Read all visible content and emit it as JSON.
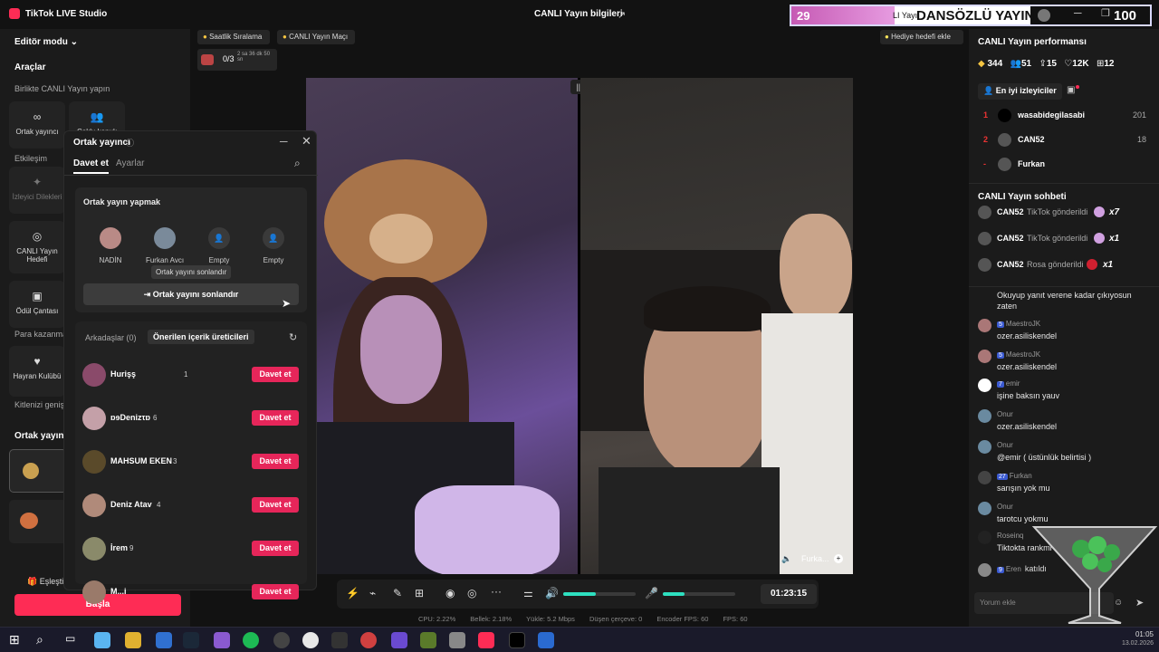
{
  "app": {
    "title": "TikTok LIVE Studio",
    "window_title": "CANLI Yayın bilgileri"
  },
  "overlay": {
    "num1": "29",
    "title": "DANSÖZLÜ YAYIN",
    "sub": "LI Yayı",
    "num2": "100"
  },
  "left": {
    "editor_mode": "Editör modu",
    "tools": "Araçlar",
    "together": "Birlikte CANLI Yayın yapın",
    "cohost_btn": "Ortak yayıncı",
    "multi_btn": "Çoklu konuk",
    "engagement": "Etkileşim",
    "requests": "İzleyici Dilekleri",
    "goal": "CANLI Yayın Hedefi",
    "bag": "Ödül Çantası",
    "earn": "Para kazanma",
    "fanclub": "Hayran Kulübü",
    "expand": "Kitlenizi genişletin",
    "cohost_section": "Ortak yayıncı",
    "match": "Eşleştir",
    "start": "Başla"
  },
  "top_chips": {
    "hourly": "Saatlik Sıralama",
    "match": "CANLI Yayın Maçı",
    "progress": "0/3",
    "progress_sub": "2 sa 36 dk 50 sn",
    "gift_goal": "Hediye hedefi ekle"
  },
  "modal": {
    "title": "Ortak yayıncı",
    "tab_invite": "Davet et",
    "tab_settings": "Ayarlar",
    "card_title": "Ortak yayın yapmak",
    "slots": [
      {
        "label": "NADİN",
        "color": "#b98a86"
      },
      {
        "label": "Furkan Avcı",
        "color": "#7a8a9a"
      },
      {
        "label": "Empty",
        "color": "#3a3a3a"
      },
      {
        "label": "Empty",
        "color": "#3a3a3a"
      }
    ],
    "tooltip": "Ortak yayını sonlandır",
    "end_btn": "Ortak yayını sonlandır",
    "friends_tab": "Arkadaşlar (0)",
    "recommended_tab": "Önerilen içerik üreticileri",
    "invite_label": "Davet et",
    "rows": [
      {
        "name": "Hurişş",
        "count": "1",
        "color": "#8a4a6a"
      },
      {
        "name": "ɒɘDenizτɒ",
        "count": "6",
        "color": "#c4a0a8"
      },
      {
        "name": "MAHSUM EKEN",
        "count": "3",
        "color": "#5a4a2a"
      },
      {
        "name": "Deniz Atav",
        "count": "4",
        "color": "#b08a7a"
      },
      {
        "name": "İrem",
        "count": "9",
        "color": "#8a8a6a"
      },
      {
        "name": "M...i",
        "count": "",
        "color": "#9a7a6a"
      }
    ]
  },
  "video": {
    "right_label": "Furka..."
  },
  "controls": {
    "timer": "01:23:15"
  },
  "stats": {
    "cpu": "CPU:  2.22%",
    "mem": "Bellek:  2.18%",
    "upload": "Yükle:  5.2 Mbps",
    "drop": "Düşen çerçeve:  0",
    "encoder": "Encoder FPS:  60",
    "fps": "FPS:  60"
  },
  "right": {
    "perf_title": "CANLI Yayın performansı",
    "metrics": [
      "344",
      "51",
      "15",
      "12K",
      "12"
    ],
    "top_viewers": "En iyi izleyiciler",
    "viewers": [
      {
        "rank": "1",
        "name": "wasabidegilasabi",
        "score": "201"
      },
      {
        "rank": "2",
        "name": "CAN52",
        "score": "18"
      },
      {
        "rank": "-",
        "name": "Furkan",
        "score": ""
      }
    ],
    "chat_title": "CANLI Yayın sohbeti",
    "gifts": [
      {
        "user": "CAN52",
        "text": "TikTok gönderildi",
        "mult": "x7"
      },
      {
        "user": "CAN52",
        "text": "TikTok gönderildi",
        "mult": "x1"
      },
      {
        "user": "CAN52",
        "text": "Rosa gönderildi",
        "mult": "x1"
      }
    ],
    "messages": [
      {
        "user": "",
        "badge": "",
        "msg": "Okuyup yanıt verene kadar çıkıyosun zaten",
        "color": "#555"
      },
      {
        "user": "MaestroJK",
        "badge": "5",
        "msg": "ozer.asiliskendel",
        "color": "#a77"
      },
      {
        "user": "MaestroJK",
        "badge": "5",
        "msg": "ozer.asiliskendel",
        "color": "#a77"
      },
      {
        "user": "emir",
        "badge": "7",
        "msg": "işine baksın yauv",
        "color": "#fff"
      },
      {
        "user": "Onur",
        "badge": "",
        "msg": "ozer.asiliskendel",
        "color": "#6a8aa0"
      },
      {
        "user": "Onur",
        "badge": "",
        "msg": "@emir ( üstünlük belirtisi )",
        "color": "#6a8aa0"
      },
      {
        "user": "Furkan",
        "badge": "27",
        "msg": "sarışın yok mu",
        "color": "#444"
      },
      {
        "user": "Onur",
        "badge": "",
        "msg": "tarotcu yokmu",
        "color": "#6a8aa0"
      },
      {
        "user": "Roseinq",
        "badge": "",
        "msg": "Tiktokta rankmi",
        "color": "#222"
      },
      {
        "user": "Eren",
        "badge": "9",
        "msg": "katıldı",
        "color": "#888"
      }
    ],
    "comment_placeholder": "Yorum ekle"
  },
  "taskbar": {
    "time": "01:05",
    "date": "13.02.2026"
  }
}
